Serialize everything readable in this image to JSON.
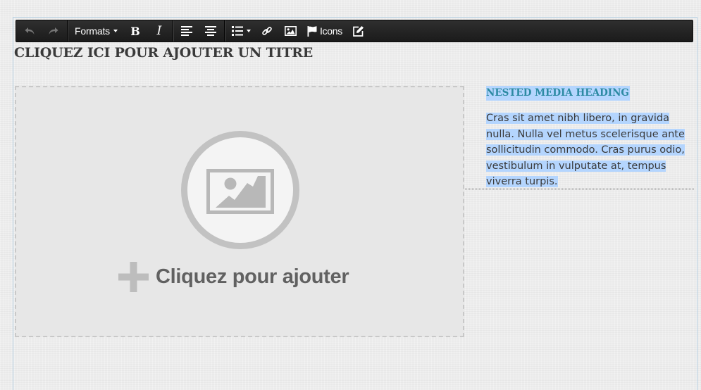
{
  "toolbar": {
    "undo_icon": "undo-icon",
    "redo_icon": "redo-icon",
    "formats_label": "Formats",
    "bold_label": "B",
    "italic_label": "I",
    "icons_label": "Icons"
  },
  "page": {
    "title": "CLIQUEZ ICI POUR AJOUTER UN TITRE"
  },
  "media": {
    "add_label": "Cliquez pour ajouter"
  },
  "nested": {
    "heading": "NESTED MEDIA HEADING",
    "body": "Cras sit amet nibh libero, in gravida nulla. Nulla vel metus scelerisque ante sollicitudin commodo. Cras purus odio, vestibulum in vulputate at, tempus viverra turpis."
  },
  "colors": {
    "toolbar_bg": "#1f1f1f",
    "selection": "#b4d5fe",
    "heading": "#2c8aa3",
    "placeholder_gray": "#c2c2c2"
  }
}
